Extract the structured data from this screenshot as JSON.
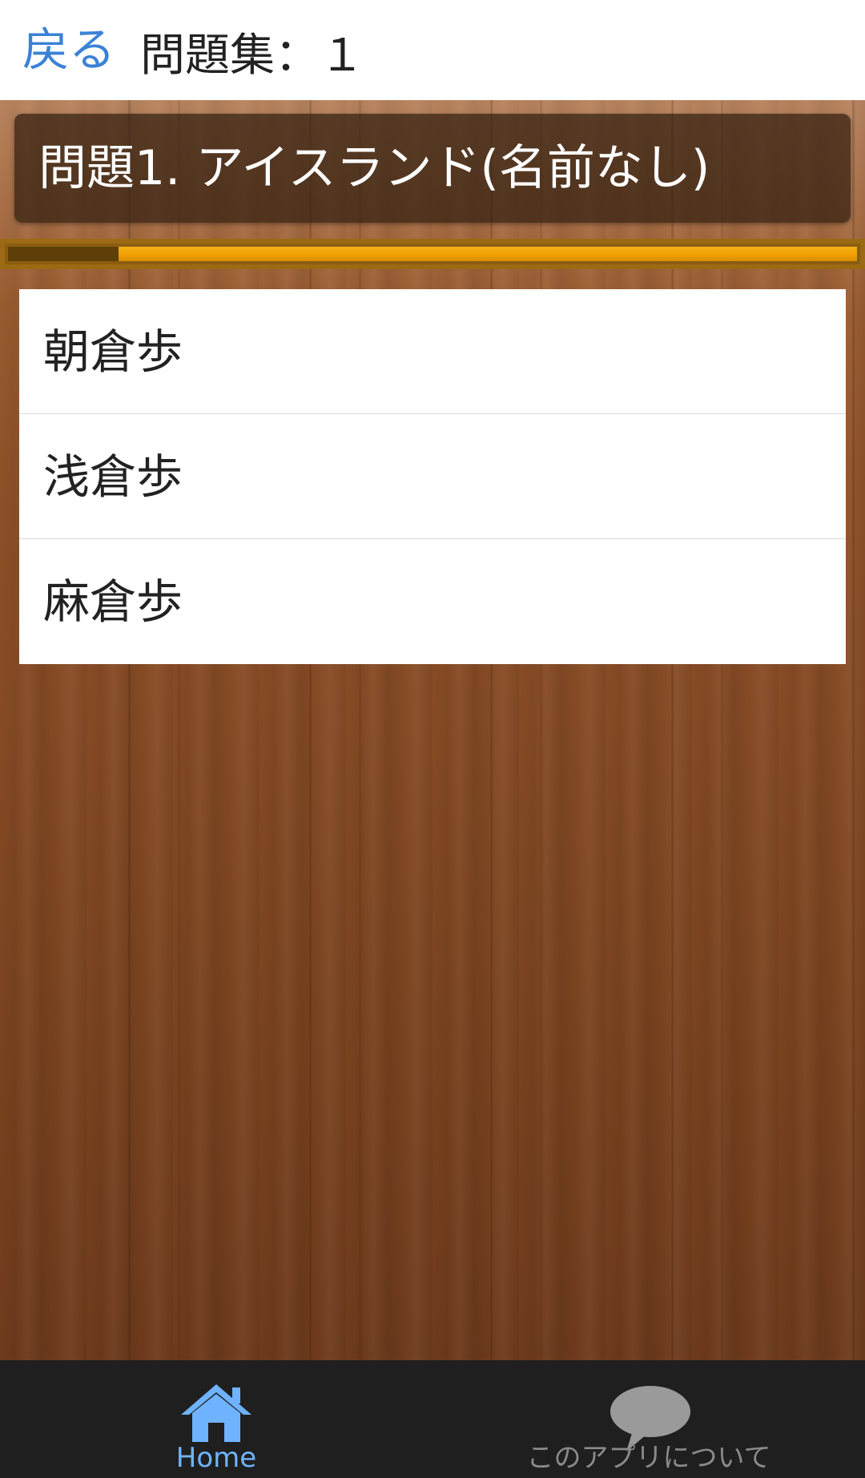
{
  "header": {
    "back_label": "戻る",
    "title": "問題集：１"
  },
  "question": {
    "text": "問題1. アイスランド(名前なし)"
  },
  "progress": {
    "fraction": 0.13,
    "fill_color": "#5e3f07",
    "track_color": "#f0a000"
  },
  "answers": [
    {
      "label": "朝倉歩"
    },
    {
      "label": "浅倉歩"
    },
    {
      "label": "麻倉歩"
    }
  ],
  "bottom_nav": {
    "items": [
      {
        "label": "Home",
        "icon": "home-icon",
        "color": "#6fb3ff",
        "active": true
      },
      {
        "label": "このアプリについて",
        "icon": "speech-bubble-icon",
        "color": "#8a8a8a",
        "active": false
      }
    ]
  }
}
